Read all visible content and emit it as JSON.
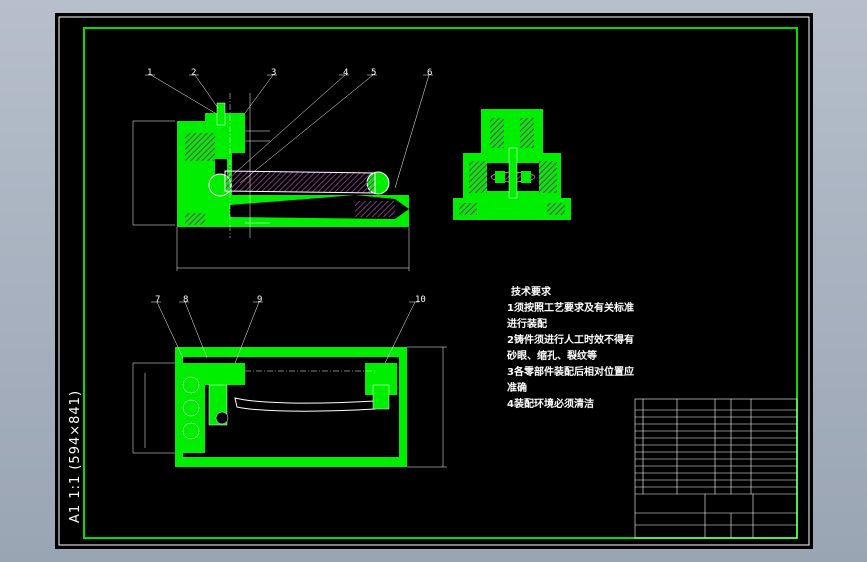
{
  "balloons_top": [
    "1",
    "2",
    "3",
    "4",
    "5",
    "6"
  ],
  "balloons_bottom": [
    "7",
    "8",
    "9",
    "10"
  ],
  "tech": {
    "title": "技术要求",
    "lines": [
      "1须按照工艺要求及有关标准",
      "进行装配",
      "2铸件须进行人工时效不得有",
      "砂眼、缩孔、裂纹等",
      "3各零部件装配后相对位置应",
      "准确",
      "4装配环境必须清洁"
    ]
  },
  "side_label": "A1  1:1   (594×841)",
  "colors": {
    "border": "#00e000",
    "part": "#00ee00",
    "line": "#ffffff",
    "hatch": "#7a3a7a"
  }
}
